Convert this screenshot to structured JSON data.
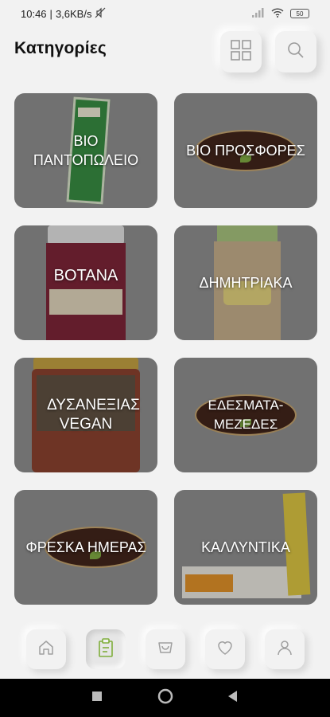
{
  "status_bar": {
    "time": "10:46",
    "network_speed": "3,6KB/s",
    "battery": "50"
  },
  "header": {
    "title": "Κατηγορίες",
    "grid_icon": "grid-view-icon",
    "search_icon": "search-icon"
  },
  "categories": [
    {
      "label": "ΒΙΟ ΠΑΝΤΟΠΩΛΕΙΟ",
      "image": "green product pack"
    },
    {
      "label": "ΒΙΟ ΠΡΟΣΦΟΡΕΣ",
      "image": "brand oval logo"
    },
    {
      "label": "BOTANA",
      "image": "supplement jar"
    },
    {
      "label": "ΔΗΜΗΤΡΙΑΚΑ",
      "image": "cereal bag"
    },
    {
      "label": "ΔΥΣΑΝΕΞΙΑΣ VEGAN",
      "image": "sauce jar"
    },
    {
      "label": "ΕΔΕΣΜΑΤΑ-ΜΕΖΕΔΕΣ",
      "image": "brand oval logo"
    },
    {
      "label": "ΦΡΕΣΚΑ ΗΜΕΡΑΣ",
      "image": "brand oval logo"
    },
    {
      "label": "ΚΑΛΛΥΝΤΙΚΑ",
      "image": "cream tube"
    }
  ],
  "bottom_nav": [
    {
      "icon": "home-icon",
      "active": false
    },
    {
      "icon": "categories-icon",
      "active": true
    },
    {
      "icon": "cart-icon",
      "active": false
    },
    {
      "icon": "heart-icon",
      "active": false
    },
    {
      "icon": "user-icon",
      "active": false
    }
  ],
  "colors": {
    "background": "#f2f2f2",
    "tile": "#8e8e8e",
    "accent_green": "#7fae3b"
  }
}
